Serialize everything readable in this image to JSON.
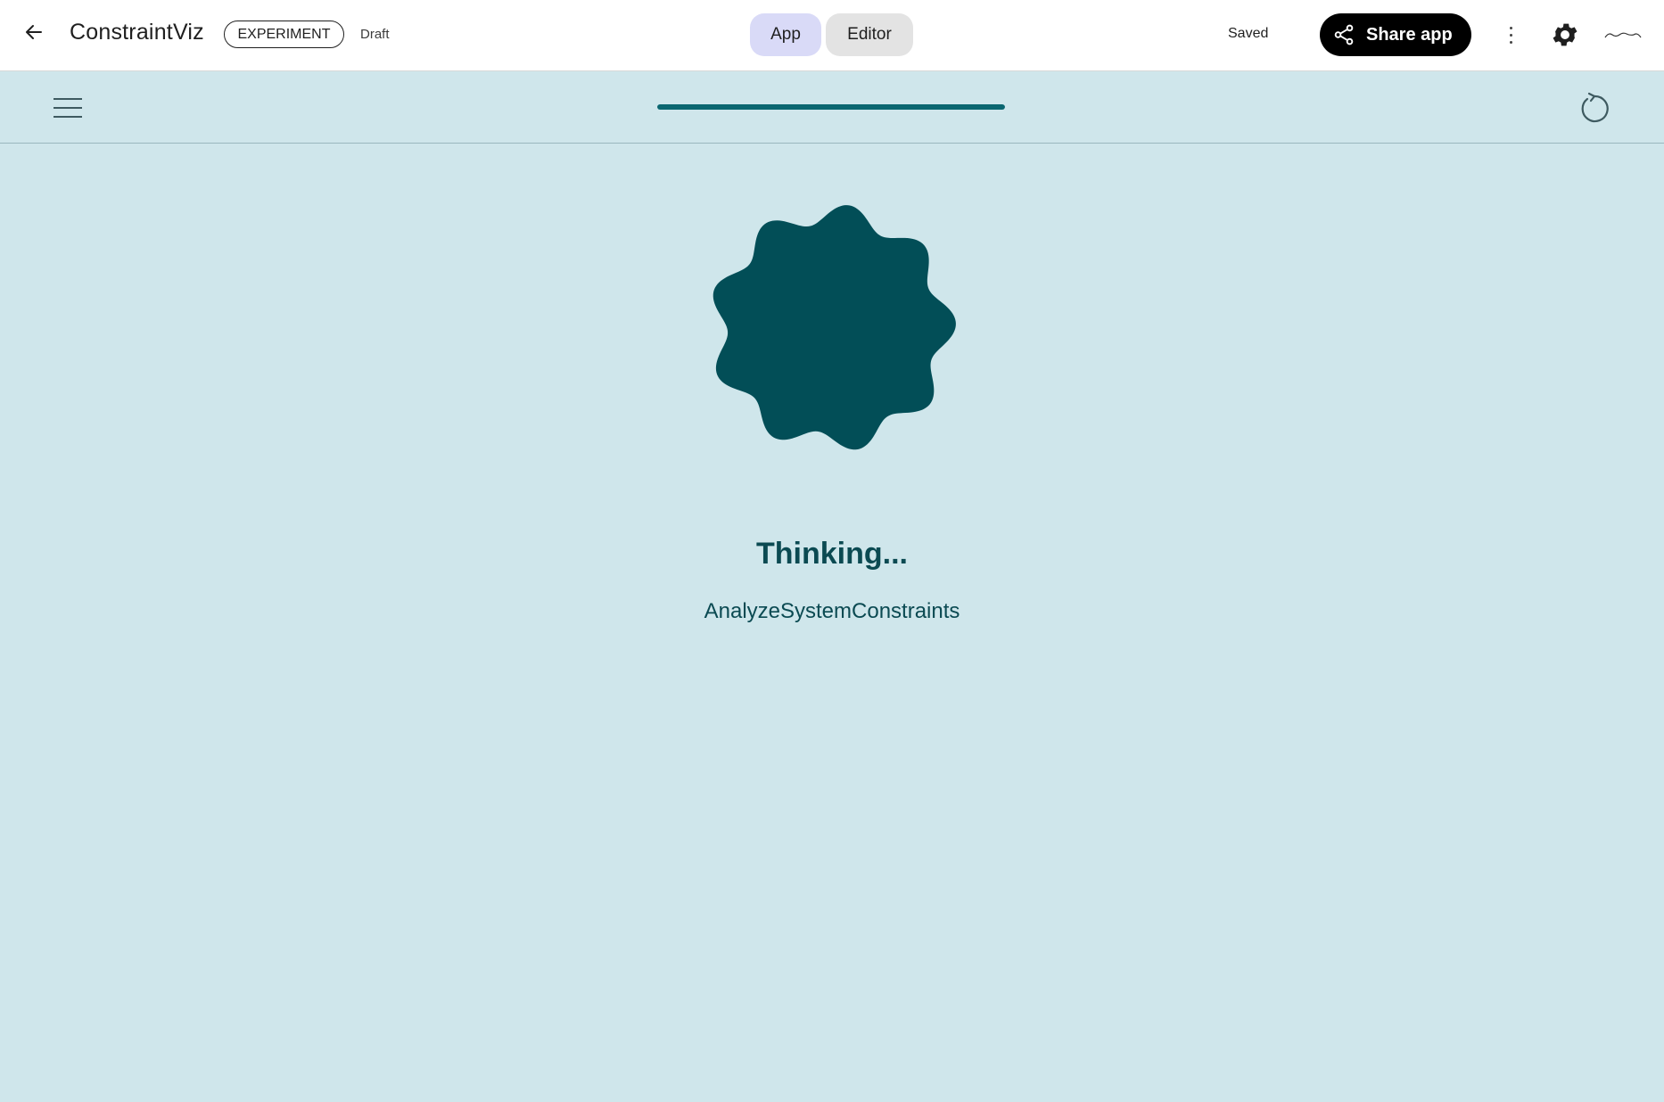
{
  "header": {
    "app_title": "ConstraintViz",
    "badge": "EXPERIMENT",
    "status": "Draft",
    "tabs": [
      {
        "label": "App",
        "active": true
      },
      {
        "label": "Editor",
        "active": false
      }
    ],
    "save_state": "Saved",
    "share_label": "Share app",
    "icons": {
      "back": "arrow-left-icon",
      "share": "share-icon",
      "more": "more-vert-icon",
      "settings": "gear-icon",
      "avatar": "avatar"
    }
  },
  "toolbar": {
    "menu_icon": "hamburger-menu-icon",
    "refresh_icon": "refresh-icon",
    "progress": 1.0
  },
  "main": {
    "status_title": "Thinking...",
    "step_name": "AnalyzeSystemConstraints"
  },
  "colors": {
    "background": "#cfe6eb",
    "accent": "#0a6670",
    "blob": "#024e57",
    "text_dark": "#0b4a52",
    "tab_active": "#d9daf7",
    "tab_inactive": "#e3e3e3",
    "share_bg": "#000000"
  }
}
